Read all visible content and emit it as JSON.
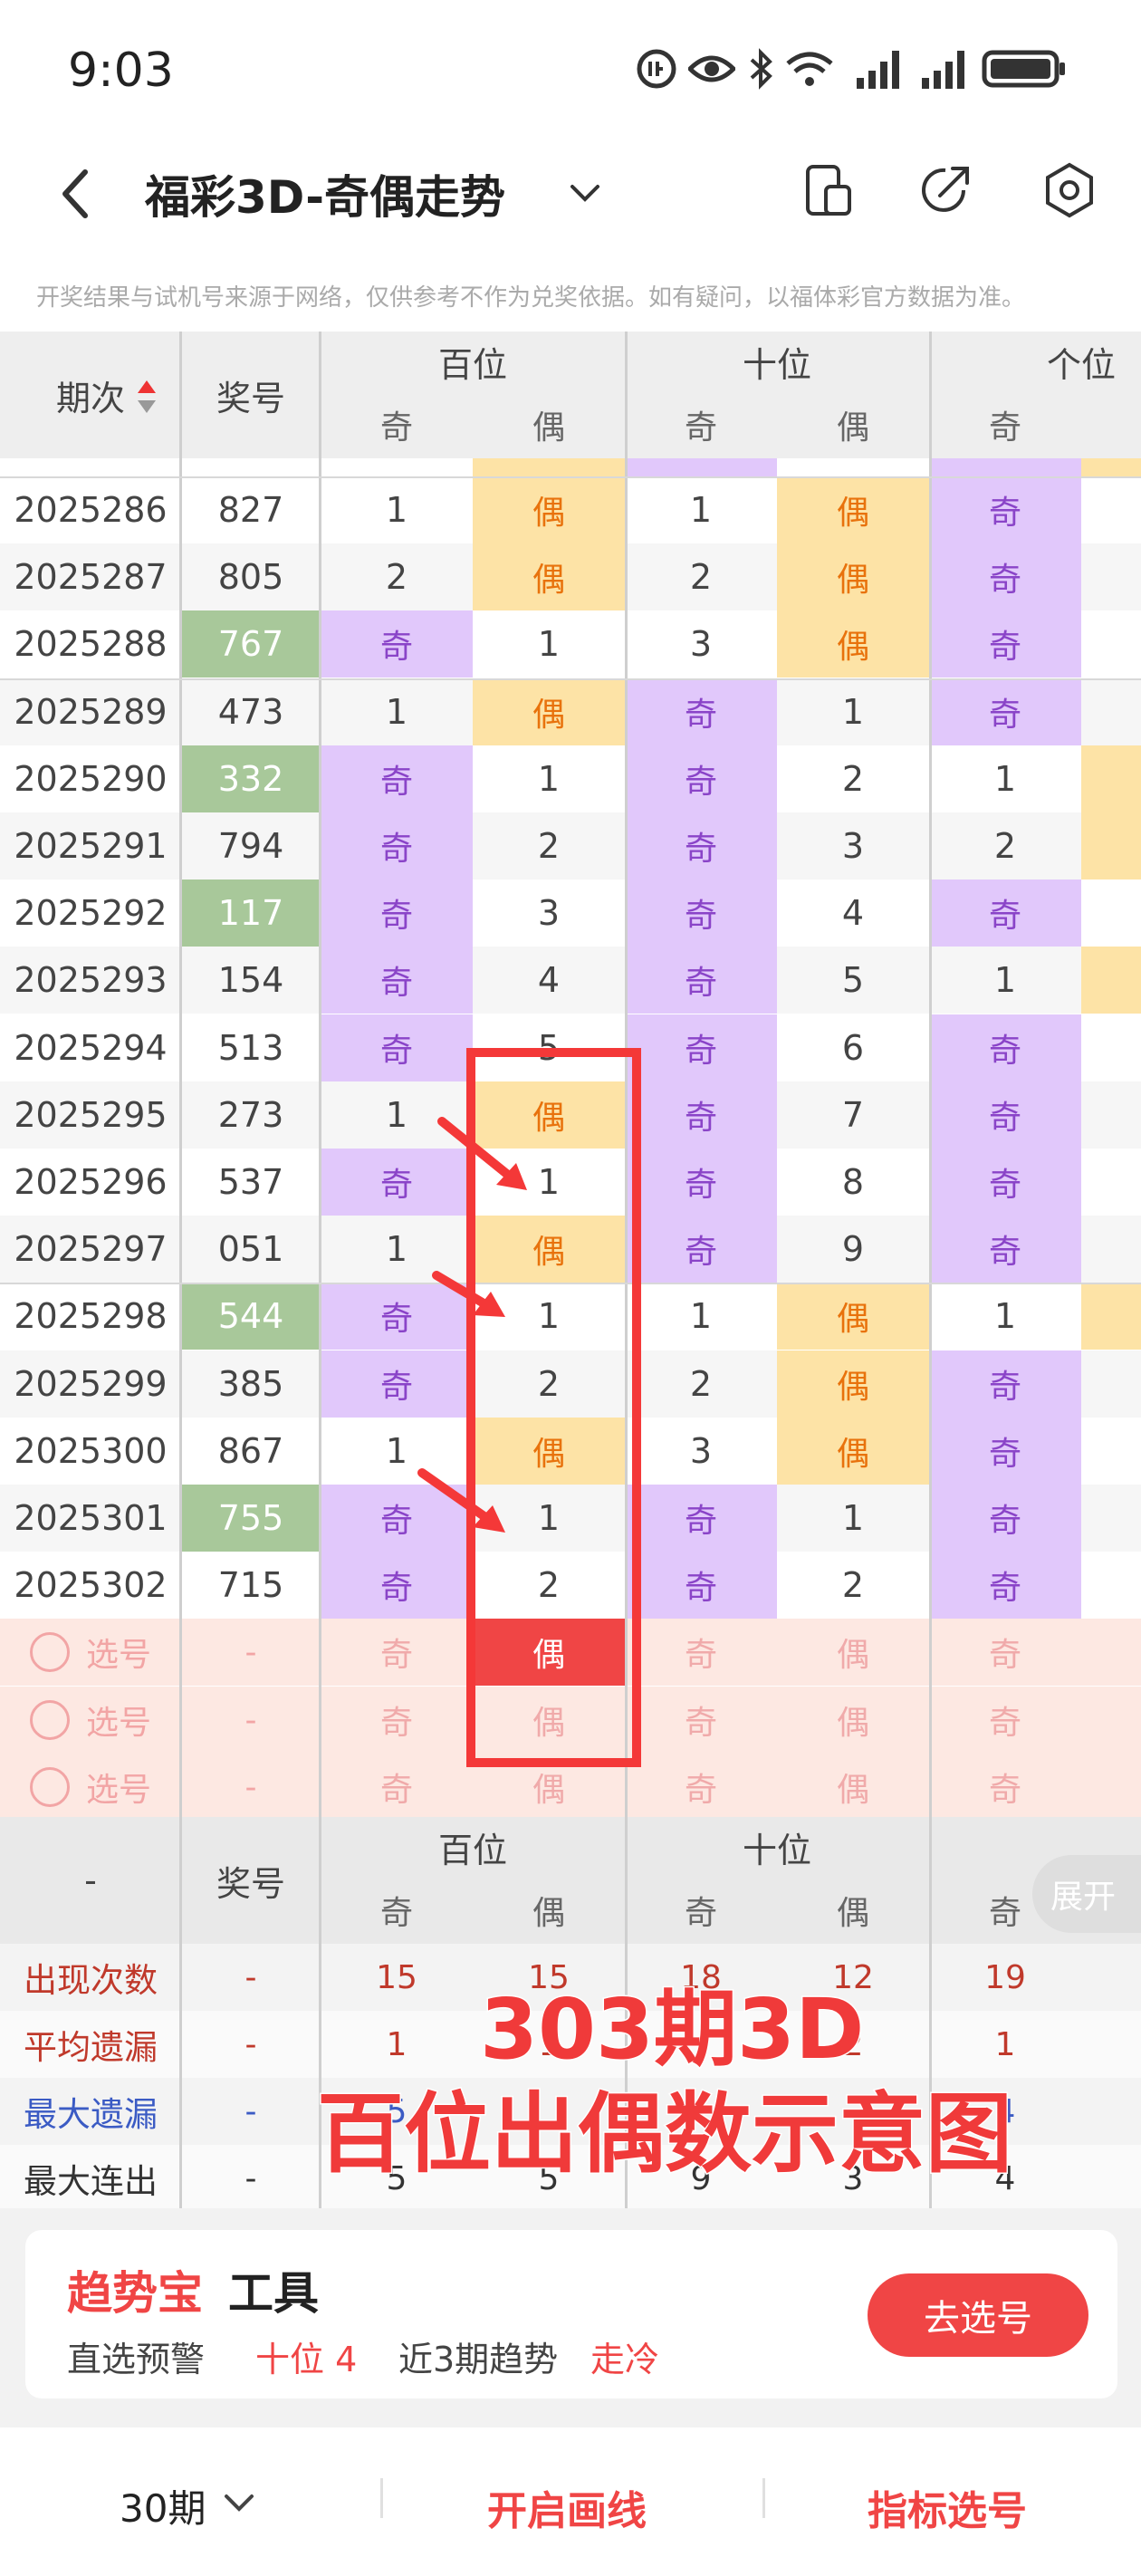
{
  "status_bar": {
    "time": "9:03"
  },
  "header": {
    "title": "福彩3D-奇偶走势"
  },
  "disclaimer": "开奖结果与试机号来源于网络，仅供参考不作为兑奖依据。如有疑问，以福体彩官方数据为准。",
  "table": {
    "col_period": "期次",
    "col_number": "奖号",
    "groups": [
      "百位",
      "十位",
      "个位"
    ],
    "odd": "奇",
    "even": "偶",
    "rows": [
      {
        "period": "2025286",
        "number": "827",
        "b": [
          "1",
          "偶"
        ],
        "s": [
          "1",
          "偶"
        ],
        "g": "奇",
        "hl": false
      },
      {
        "period": "2025287",
        "number": "805",
        "b": [
          "2",
          "偶"
        ],
        "s": [
          "2",
          "偶"
        ],
        "g": "奇",
        "hl": false
      },
      {
        "period": "2025288",
        "number": "767",
        "b": [
          "奇",
          "1"
        ],
        "s": [
          "3",
          "偶"
        ],
        "g": "奇",
        "hl": true
      },
      {
        "period": "2025289",
        "number": "473",
        "b": [
          "1",
          "偶"
        ],
        "s": [
          "奇",
          "1"
        ],
        "g": "奇",
        "hl": false
      },
      {
        "period": "2025290",
        "number": "332",
        "b": [
          "奇",
          "1"
        ],
        "s": [
          "奇",
          "2"
        ],
        "g": "1",
        "hl": true
      },
      {
        "period": "2025291",
        "number": "794",
        "b": [
          "奇",
          "2"
        ],
        "s": [
          "奇",
          "3"
        ],
        "g": "2",
        "hl": false
      },
      {
        "period": "2025292",
        "number": "117",
        "b": [
          "奇",
          "3"
        ],
        "s": [
          "奇",
          "4"
        ],
        "g": "奇",
        "hl": true
      },
      {
        "period": "2025293",
        "number": "154",
        "b": [
          "奇",
          "4"
        ],
        "s": [
          "奇",
          "5"
        ],
        "g": "1",
        "hl": false
      },
      {
        "period": "2025294",
        "number": "513",
        "b": [
          "奇",
          "5"
        ],
        "s": [
          "奇",
          "6"
        ],
        "g": "奇",
        "hl": false
      },
      {
        "period": "2025295",
        "number": "273",
        "b": [
          "1",
          "偶"
        ],
        "s": [
          "奇",
          "7"
        ],
        "g": "奇",
        "hl": false
      },
      {
        "period": "2025296",
        "number": "537",
        "b": [
          "奇",
          "1"
        ],
        "s": [
          "奇",
          "8"
        ],
        "g": "奇",
        "hl": false
      },
      {
        "period": "2025297",
        "number": "051",
        "b": [
          "1",
          "偶"
        ],
        "s": [
          "奇",
          "9"
        ],
        "g": "奇",
        "hl": false
      },
      {
        "period": "2025298",
        "number": "544",
        "b": [
          "奇",
          "1"
        ],
        "s": [
          "1",
          "偶"
        ],
        "g": "1",
        "hl": true
      },
      {
        "period": "2025299",
        "number": "385",
        "b": [
          "奇",
          "2"
        ],
        "s": [
          "2",
          "偶"
        ],
        "g": "奇",
        "hl": false
      },
      {
        "period": "2025300",
        "number": "867",
        "b": [
          "1",
          "偶"
        ],
        "s": [
          "3",
          "偶"
        ],
        "g": "奇",
        "hl": false
      },
      {
        "period": "2025301",
        "number": "755",
        "b": [
          "奇",
          "1"
        ],
        "s": [
          "奇",
          "1"
        ],
        "g": "奇",
        "hl": true
      },
      {
        "period": "2025302",
        "number": "715",
        "b": [
          "奇",
          "2"
        ],
        "s": [
          "奇",
          "2"
        ],
        "g": "奇",
        "hl": false
      }
    ],
    "pick_label": "选号",
    "pick_dash": "-",
    "expand": "展开"
  },
  "stats": {
    "dash": "-",
    "col_number": "奖号",
    "rows": [
      {
        "label": "出现次数",
        "values": [
          "15",
          "15",
          "18",
          "12",
          "19"
        ],
        "color": "#c0392b"
      },
      {
        "label": "平均遗漏",
        "values": [
          "1",
          "1",
          "",
          "2",
          "1"
        ],
        "color": "#c0392b"
      },
      {
        "label": "最大遗漏",
        "values": [
          "5",
          "",
          "",
          "",
          "4"
        ],
        "color": "#3b5bc4"
      },
      {
        "label": "最大连出",
        "values": [
          "5",
          "5",
          "9",
          "3",
          "4"
        ],
        "color": "#333333"
      }
    ]
  },
  "overlay": {
    "line1": "303期3D",
    "line2": "百位出偶数示意图"
  },
  "tool": {
    "title_red": "趋势宝",
    "title_black": "工具",
    "line_a": "直选预警",
    "line_b": "十位 4",
    "line_c": "近3期趋势",
    "line_d": "走冷",
    "button": "去选号"
  },
  "tabbar": {
    "periods": "30期",
    "draw": "开启画线",
    "indicator": "指标选号"
  },
  "colors": {
    "odd_bg": "#e1c8fb",
    "even_bg": "#fde3a6",
    "hl_bg": "#a8c89a",
    "accent": "#f04545"
  }
}
